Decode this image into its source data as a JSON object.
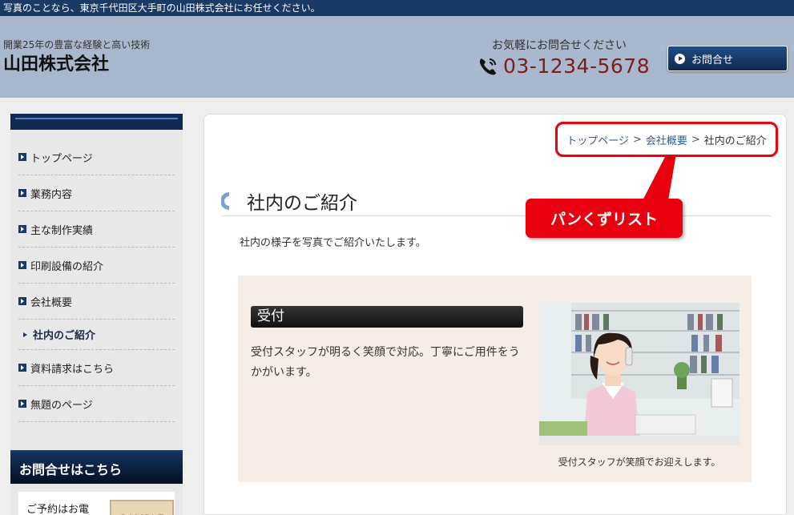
{
  "topbar": {
    "text": "写真のことなら、東京千代田区大手町の山田株式会社にお任せください。"
  },
  "header": {
    "tagline": "開業25年の豊富な経験と高い技術",
    "company": "山田株式会社",
    "contact_prompt": "お気軽にお問合せください",
    "phone": "03-1234-5678",
    "contact_button": "お問合せ"
  },
  "sidebar": {
    "items": [
      {
        "label": "トップページ"
      },
      {
        "label": "業務内容"
      },
      {
        "label": "主な制作実績"
      },
      {
        "label": "印刷設備の紹介"
      },
      {
        "label": "会社概要"
      },
      {
        "label": "社内のご紹介"
      },
      {
        "label": "資料請求はこちら"
      },
      {
        "label": "無題のページ"
      }
    ],
    "contact_heading": "お問合せはこちら",
    "contact_text": "ご予約はお電話…",
    "sample_label": "SAMPLE"
  },
  "breadcrumb": {
    "items": [
      "トップページ",
      "会社概要",
      "社内のご紹介"
    ],
    "separator": ">"
  },
  "callout": {
    "label": "パンくずリスト"
  },
  "content": {
    "title": "社内のご紹介",
    "intro": "社内の様子を写真でご紹介いたします。",
    "section_heading": "受付",
    "section_text": "受付スタッフが明るく笑顔で対応。丁寧にご用件をうかがいます。",
    "photo_caption": "受付スタッフが笑顔でお迎えします。"
  },
  "colors": {
    "navy": "#1a3a66",
    "header_bg": "#a9b8cc",
    "highlight_red": "#e8000f",
    "phone_text": "#7a1d1d",
    "panel_bg": "#f6ede6"
  }
}
